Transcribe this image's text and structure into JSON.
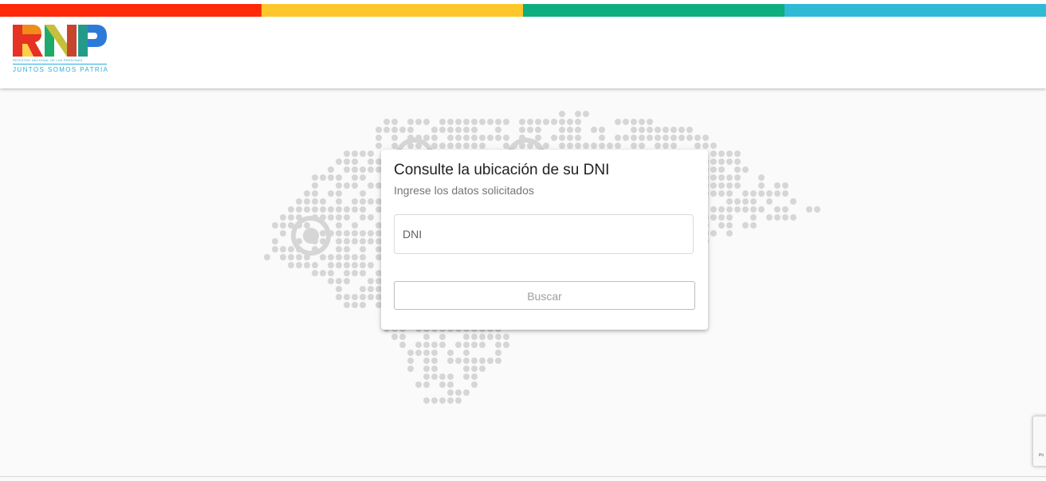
{
  "brand": {
    "logo_text": "RNP",
    "logo_subtitle": "REGISTRO NACIONAL DE LAS PERSONAS",
    "tagline": "JUNTOS SOMOS PATRIA",
    "stripe_colors": [
      "#ff2a0a",
      "#fdc72c",
      "#0fae7e",
      "#2fbad6"
    ],
    "logo_colors": [
      "#f08c1a",
      "#e53223",
      "#1faa6b",
      "#2d7bd8",
      "#fdc72c"
    ]
  },
  "card": {
    "title": "Consulte la ubicación de su DNI",
    "subtitle": "Ingrese los datos solicitados",
    "dni_placeholder": "DNI",
    "dni_value": "",
    "search_label": "Buscar"
  },
  "recaptcha": {
    "text": "Pri"
  },
  "colors": {
    "map_dots": "#d6d6d6",
    "page_bg": "#fafafa"
  }
}
